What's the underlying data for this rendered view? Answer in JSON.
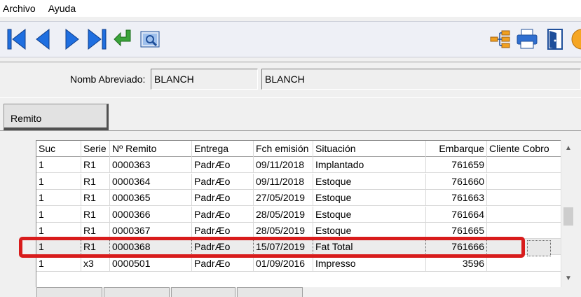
{
  "menu": [
    "Archivo",
    "Ayuda"
  ],
  "toolbar": {
    "left": [
      "first-record-icon",
      "previous-record-icon",
      "next-record-icon",
      "last-record-icon",
      "return-icon",
      "preview-icon"
    ],
    "right": [
      "tree-view-icon",
      "print-icon",
      "exit-door-icon",
      "help-icon"
    ]
  },
  "header": {
    "nomb_label": "Nomb Abreviado:",
    "nomb_value": "BLANCH",
    "nomb_full": "BLANCH"
  },
  "tab": {
    "label": "Remito"
  },
  "grid": {
    "columns": [
      "Suc",
      "Serie",
      "Nº Remito",
      "Entrega",
      "Fch emisión",
      "Situación",
      "Embarque",
      "Cliente Cobro"
    ],
    "rows": [
      [
        "1",
        "R1",
        "0000363",
        "PadrÆo",
        "09/11/2018",
        "Implantado",
        "761659",
        ""
      ],
      [
        "1",
        "R1",
        "0000364",
        "PadrÆo",
        "09/11/2018",
        "Estoque",
        "761660",
        ""
      ],
      [
        "1",
        "R1",
        "0000365",
        "PadrÆo",
        "27/05/2019",
        "Estoque",
        "761663",
        ""
      ],
      [
        "1",
        "R1",
        "0000366",
        "PadrÆo",
        "28/05/2019",
        "Estoque",
        "761664",
        ""
      ],
      [
        "1",
        "R1",
        "0000367",
        "PadrÆo",
        "28/05/2019",
        "Estoque",
        "761665",
        ""
      ],
      [
        "1",
        "R1",
        "0000368",
        "PadrÆo",
        "15/07/2019",
        "Fat Total",
        "761666",
        ""
      ],
      [
        "1",
        "x3",
        "0000501",
        "PadrÆo",
        "01/09/2016",
        "Impresso",
        "3596",
        ""
      ]
    ],
    "selected_row_index": 5
  },
  "colors": {
    "highlight": "#d81c1c",
    "nav_blue": "#1f6fe0",
    "return_green": "#3aa33a"
  }
}
